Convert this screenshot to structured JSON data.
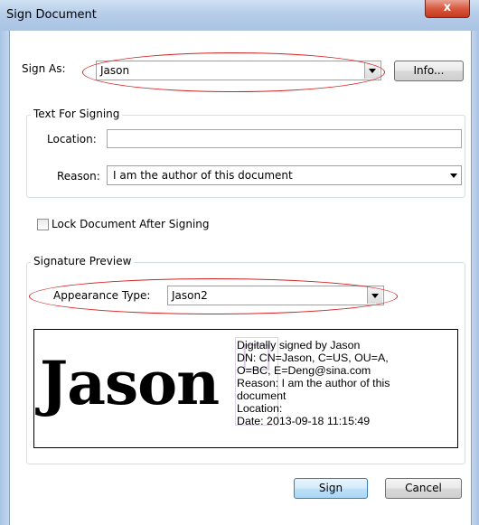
{
  "window": {
    "title": "Sign Document",
    "close_label": "x"
  },
  "sign_as": {
    "label": "Sign As:",
    "value": "Jason",
    "info_label": "Info..."
  },
  "text_for_signing": {
    "title": "Text For Signing",
    "location_label": "Location:",
    "location_value": "",
    "reason_label": "Reason:",
    "reason_value": "I am the author of this document"
  },
  "lock_document": {
    "label": "Lock Document After Signing",
    "checked": false
  },
  "signature_preview": {
    "title": "Signature Preview",
    "appearance_label": "Appearance Type:",
    "appearance_value": "Jason2",
    "big_name": "Jason",
    "lines": [
      "Digitally signed by Jason",
      "DN: CN=Jason, C=US, OU=A,",
      "O=BC, E=Deng@sina.com",
      "Reason: I am the author of this",
      "document",
      "Location:",
      "Date: 2013-09-18 11:15:49"
    ]
  },
  "buttons": {
    "sign": "Sign",
    "cancel": "Cancel"
  },
  "colors": {
    "annotation_oval": "#d32020",
    "titlebar": "#b6cde9",
    "close_button": "#c4381d"
  }
}
